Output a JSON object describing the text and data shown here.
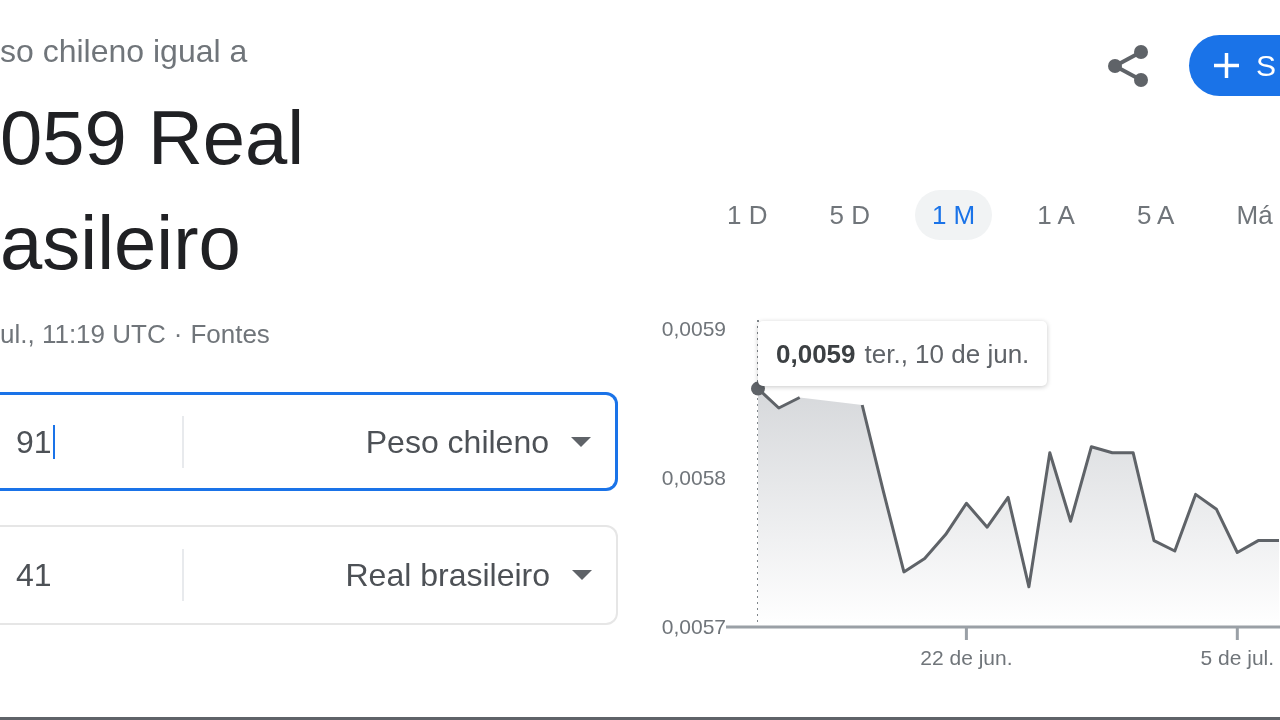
{
  "summary": {
    "subtitle": "so chileno igual a",
    "result_lines": [
      "059 Real",
      "asileiro"
    ],
    "timestamp": "ul., 11:19 UTC",
    "separator": "·",
    "sources_link": "Fontes"
  },
  "actions": {
    "follow_button": "S"
  },
  "converters": [
    {
      "amount": "91",
      "currency": "Peso chileno",
      "focused": true
    },
    {
      "amount": "41",
      "currency": "Real brasileiro",
      "focused": false
    }
  ],
  "range_tabs": [
    {
      "label": "1 D",
      "selected": false
    },
    {
      "label": "5 D",
      "selected": false
    },
    {
      "label": "1 M",
      "selected": true
    },
    {
      "label": "1 A",
      "selected": false
    },
    {
      "label": "5 A",
      "selected": false
    },
    {
      "label": "Má",
      "selected": false
    }
  ],
  "chart": {
    "chart_data": {
      "type": "area",
      "categories": [
        null,
        null,
        null,
        null,
        null,
        null,
        null,
        null,
        null,
        null,
        "22 de jun.",
        null,
        null,
        null,
        null,
        null,
        null,
        null,
        null,
        null,
        null,
        null,
        null,
        "5 de jul.",
        null,
        null
      ],
      "values": [
        0.00586,
        0.005847,
        0.005854,
        null,
        null,
        0.005849,
        0.005792,
        0.005737,
        0.005746,
        0.005762,
        0.005783,
        0.005767,
        0.005787,
        0.005727,
        0.005817,
        0.005771,
        0.005821,
        0.005817,
        0.005817,
        0.005758,
        0.005751,
        0.005789,
        0.005779,
        0.00575,
        0.005758,
        0.005758
      ],
      "ylim": [
        0.0057,
        0.0059
      ],
      "yticks": [
        {
          "value": 0.0057,
          "label": "0,0057"
        },
        {
          "value": 0.0058,
          "label": "0,0058"
        },
        {
          "value": 0.0059,
          "label": "0,0059"
        }
      ]
    },
    "tooltip": {
      "value": "0,0059",
      "date": "ter., 10 de jun."
    }
  }
}
